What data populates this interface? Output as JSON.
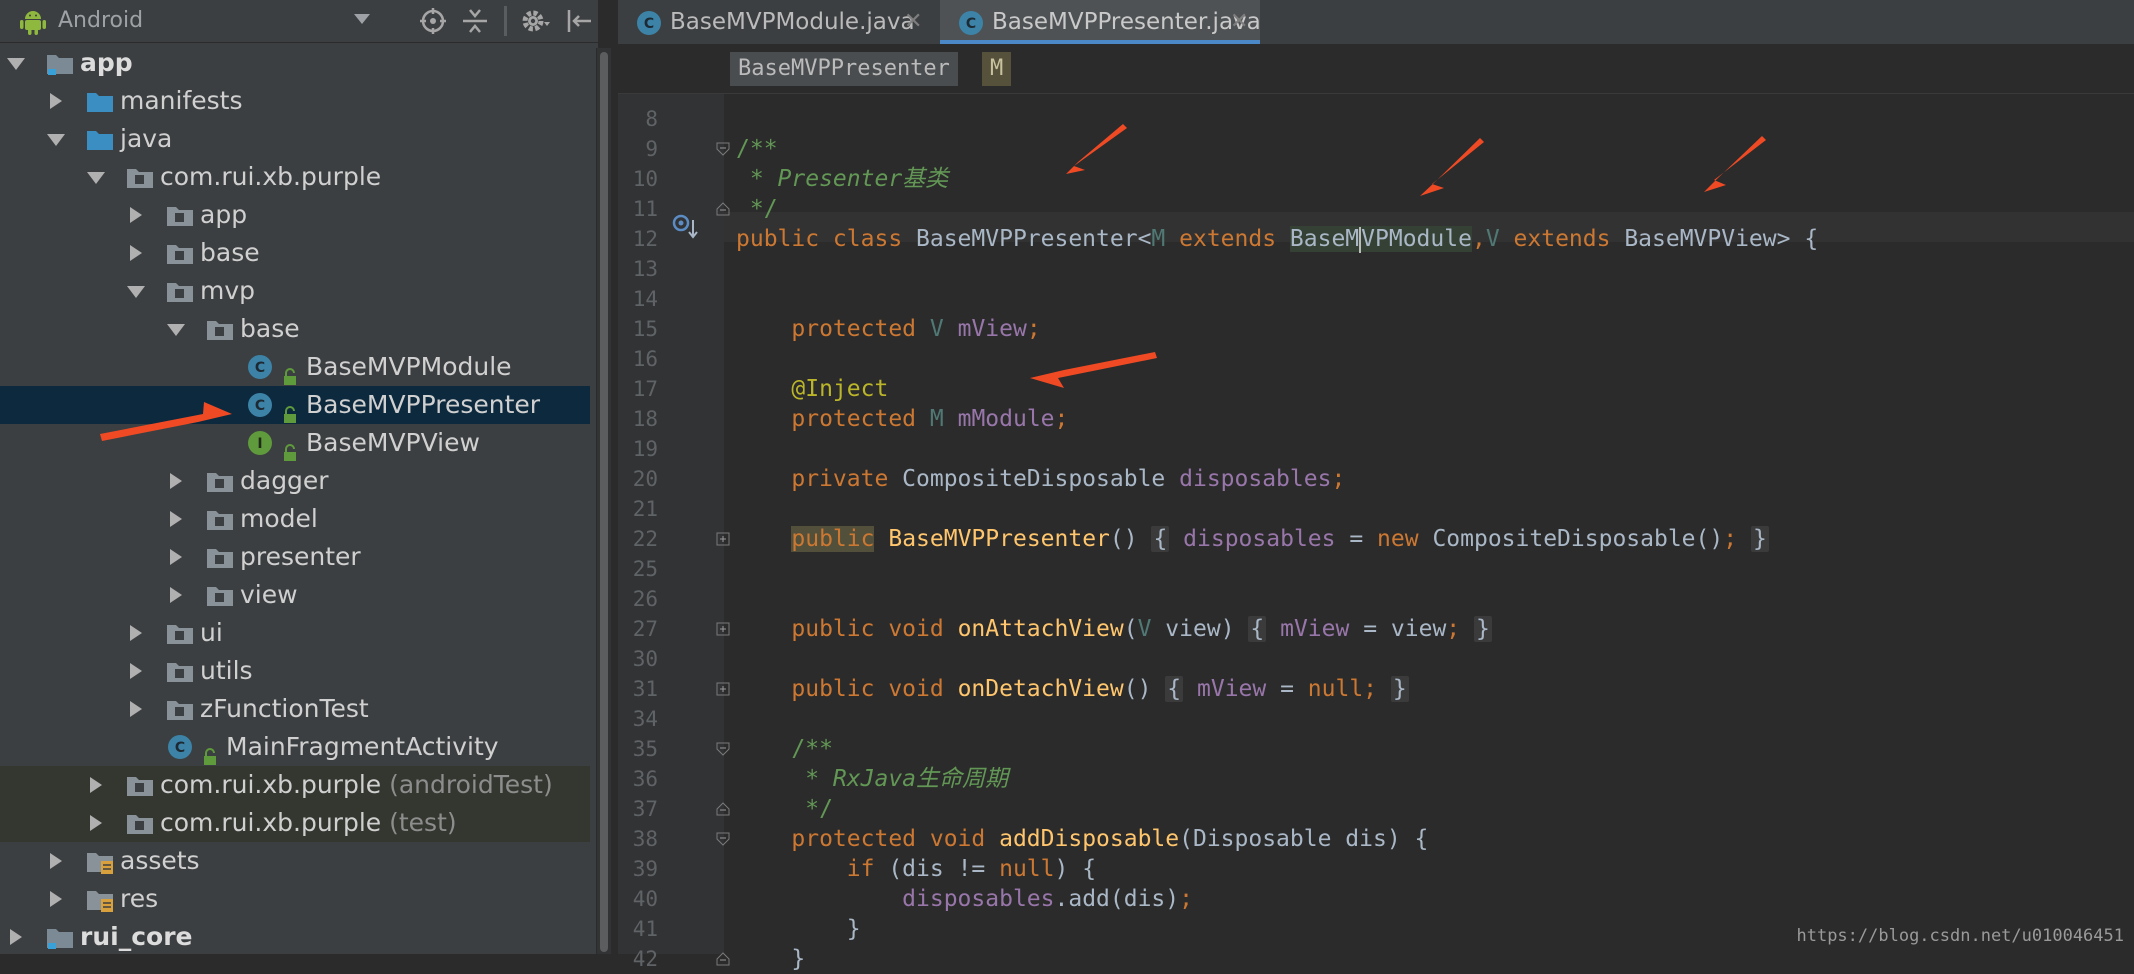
{
  "project_panel": {
    "view_selector": "Android",
    "tree": [
      {
        "label": "app",
        "level": 0,
        "state": "down",
        "icon": "module-folder-icon",
        "bold": true
      },
      {
        "label": "manifests",
        "level": 1,
        "state": "right",
        "icon": "blue-folder-icon"
      },
      {
        "label": "java",
        "level": 1,
        "state": "down",
        "icon": "blue-folder-icon"
      },
      {
        "label": "com.rui.xb.purple",
        "level": 2,
        "state": "down",
        "icon": "package-folder-icon"
      },
      {
        "label": "app",
        "level": 3,
        "state": "right",
        "icon": "package-folder-icon"
      },
      {
        "label": "base",
        "level": 3,
        "state": "right",
        "icon": "package-folder-icon"
      },
      {
        "label": "mvp",
        "level": 3,
        "state": "down",
        "icon": "package-folder-icon"
      },
      {
        "label": "base",
        "level": 4,
        "state": "down",
        "icon": "package-folder-icon"
      },
      {
        "label": "BaseMVPModule",
        "level": 5,
        "state": "none",
        "icon": "class-icon",
        "lock": true
      },
      {
        "label": "BaseMVPPresenter",
        "level": 5,
        "state": "none",
        "icon": "class-icon",
        "lock": true,
        "selected": true
      },
      {
        "label": "BaseMVPView",
        "level": 5,
        "state": "none",
        "icon": "interface-icon",
        "lock": true
      },
      {
        "label": "dagger",
        "level": 4,
        "state": "right",
        "icon": "package-folder-icon"
      },
      {
        "label": "model",
        "level": 4,
        "state": "right",
        "icon": "package-folder-icon"
      },
      {
        "label": "presenter",
        "level": 4,
        "state": "right",
        "icon": "package-folder-icon"
      },
      {
        "label": "view",
        "level": 4,
        "state": "right",
        "icon": "package-folder-icon"
      },
      {
        "label": "ui",
        "level": 3,
        "state": "right",
        "icon": "package-folder-icon"
      },
      {
        "label": "utils",
        "level": 3,
        "state": "right",
        "icon": "package-folder-icon"
      },
      {
        "label": "zFunctionTest",
        "level": 3,
        "state": "right",
        "icon": "package-folder-icon"
      },
      {
        "label": "MainFragmentActivity",
        "level": 3,
        "state": "none",
        "icon": "class-icon",
        "lock": true
      },
      {
        "label": "com.rui.xb.purple",
        "suffix": "(androidTest)",
        "level": 2,
        "state": "right",
        "icon": "package-folder-icon",
        "test": true
      },
      {
        "label": "com.rui.xb.purple",
        "suffix": "(test)",
        "level": 2,
        "state": "right",
        "icon": "package-folder-icon",
        "test": true
      },
      {
        "label": "assets",
        "level": 1,
        "state": "right",
        "icon": "resource-folder-icon"
      },
      {
        "label": "res",
        "level": 1,
        "state": "right",
        "icon": "resource-folder-icon"
      },
      {
        "label": "rui_core",
        "level": 0,
        "state": "right",
        "icon": "module-folder-icon",
        "bold": true
      }
    ]
  },
  "tabs": [
    {
      "label": "BaseMVPModule.java",
      "active": false
    },
    {
      "label": "BaseMVPPresenter.java",
      "active": true
    }
  ],
  "breadcrumb": {
    "class_name": "BaseMVPPresenter",
    "type_param": "M"
  },
  "editor": {
    "lines": [
      {
        "n": "8",
        "html": ""
      },
      {
        "n": "9",
        "html": "<span class='cmtc'>/**</span>"
      },
      {
        "n": "10",
        "html": "<span class='cmt'> * Presenter基类</span>"
      },
      {
        "n": "11",
        "html": "<span class='cmtc'> */</span>"
      },
      {
        "n": "12",
        "html": "<span class='kw'>public class </span>BaseMVPPresenter&lt;<span class='tp'>M</span> <span class='kw'>extends </span><span class='typehl'>BaseM<span class='caret'></span>VPModule</span><span class='kw'>,</span><span class='tp'>V</span> <span class='kw'>extends </span>BaseMVPView&gt; {"
      },
      {
        "n": "13",
        "html": ""
      },
      {
        "n": "14",
        "html": ""
      },
      {
        "n": "15",
        "html": "    <span class='kw'>protected </span><span class='tp'>V</span> <span class='fld'>mView</span><span class='kw'>;</span>"
      },
      {
        "n": "16",
        "html": ""
      },
      {
        "n": "17",
        "html": "    <span class='ann'>@Inject</span>"
      },
      {
        "n": "18",
        "html": "    <span class='kw'>protected </span><span class='tp'>M</span> <span class='fld'>mModule</span><span class='kw'>;</span>"
      },
      {
        "n": "19",
        "html": ""
      },
      {
        "n": "20",
        "html": "    <span class='kw'>private </span>CompositeDisposable <span class='fld'>disposables</span><span class='kw'>;</span>"
      },
      {
        "n": "21",
        "html": ""
      },
      {
        "n": "22",
        "html": "    <span class='kw pubhl'>public</span> <span class='fn'>BaseMVPPresenter</span>() <span class='fold'>{</span> <span class='fld'>disposables</span> = <span class='kw'>new </span>CompositeDisposable()<span class='kw'>;</span> <span class='fold'>}</span>"
      },
      {
        "n": "25",
        "html": ""
      },
      {
        "n": "26",
        "html": ""
      },
      {
        "n": "27",
        "html": "    <span class='kw'>public void </span><span class='fn'>onAttachView</span>(<span class='tp'>V</span> view) <span class='fold'>{</span> <span class='fld'>mView</span> = view<span class='kw'>;</span> <span class='fold'>}</span>"
      },
      {
        "n": "30",
        "html": ""
      },
      {
        "n": "31",
        "html": "    <span class='kw'>public void </span><span class='fn'>onDetachView</span>() <span class='fold'>{</span> <span class='fld'>mView</span> = <span class='kw'>null;</span> <span class='fold'>}</span>"
      },
      {
        "n": "34",
        "html": ""
      },
      {
        "n": "35",
        "html": "    <span class='cmtc'>/**</span>"
      },
      {
        "n": "36",
        "html": "<span class='cmt'>     * RxJava生命周期</span>"
      },
      {
        "n": "37",
        "html": "<span class='cmtc'>     */</span>"
      },
      {
        "n": "38",
        "html": "    <span class='kw'>protected void </span><span class='fn'>addDisposable</span>(Disposable dis) {"
      },
      {
        "n": "39",
        "html": "        <span class='kw'>if </span>(dis != <span class='kw'>null</span>) {"
      },
      {
        "n": "40",
        "html": "            <span class='fld'>disposables</span>.add(dis)<span class='kw'>;</span>"
      },
      {
        "n": "41",
        "html": "        }"
      },
      {
        "n": "42",
        "html": "    }"
      }
    ]
  },
  "watermark": "https://blog.csdn.net/u010046451",
  "colors": {
    "annotation_arrow": "#f04a24",
    "selection": "#0d293e",
    "accent": "#4a88c7"
  }
}
